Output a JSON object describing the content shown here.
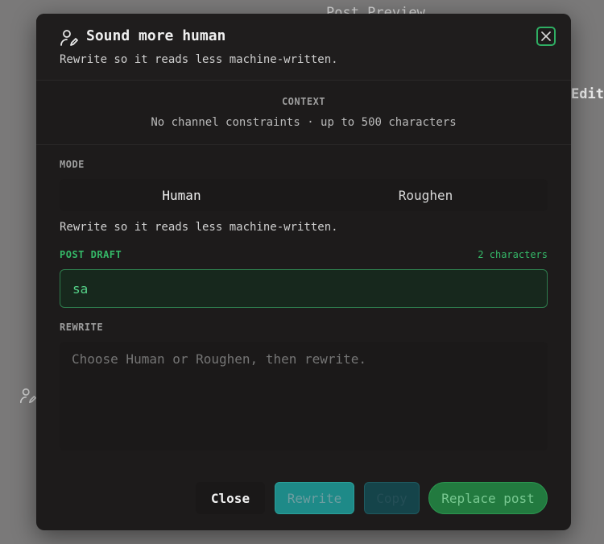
{
  "background": {
    "title": "Post Preview",
    "edit_label": "Edit"
  },
  "modal": {
    "title": "Sound more human",
    "subtitle": "Rewrite so it reads less machine-written.",
    "close_icon": "close-icon",
    "title_icon": "user-edit-icon"
  },
  "context": {
    "label": "CONTEXT",
    "value": "No channel constraints · up to 500 characters"
  },
  "mode": {
    "label": "MODE",
    "options": [
      "Human",
      "Roughen"
    ],
    "selected": "Human",
    "description": "Rewrite so it reads less machine-written."
  },
  "draft": {
    "label": "POST DRAFT",
    "char_count": "2 characters",
    "value": "sa"
  },
  "rewrite": {
    "label": "REWRITE",
    "placeholder": "Choose Human or Roughen, then rewrite."
  },
  "buttons": {
    "close": "Close",
    "rewrite": "Rewrite",
    "copy": "Copy",
    "replace": "Replace post"
  },
  "colors": {
    "accent_green": "#35b868",
    "teal": "#1e8a88",
    "modal_bg": "#1d1b1b"
  }
}
